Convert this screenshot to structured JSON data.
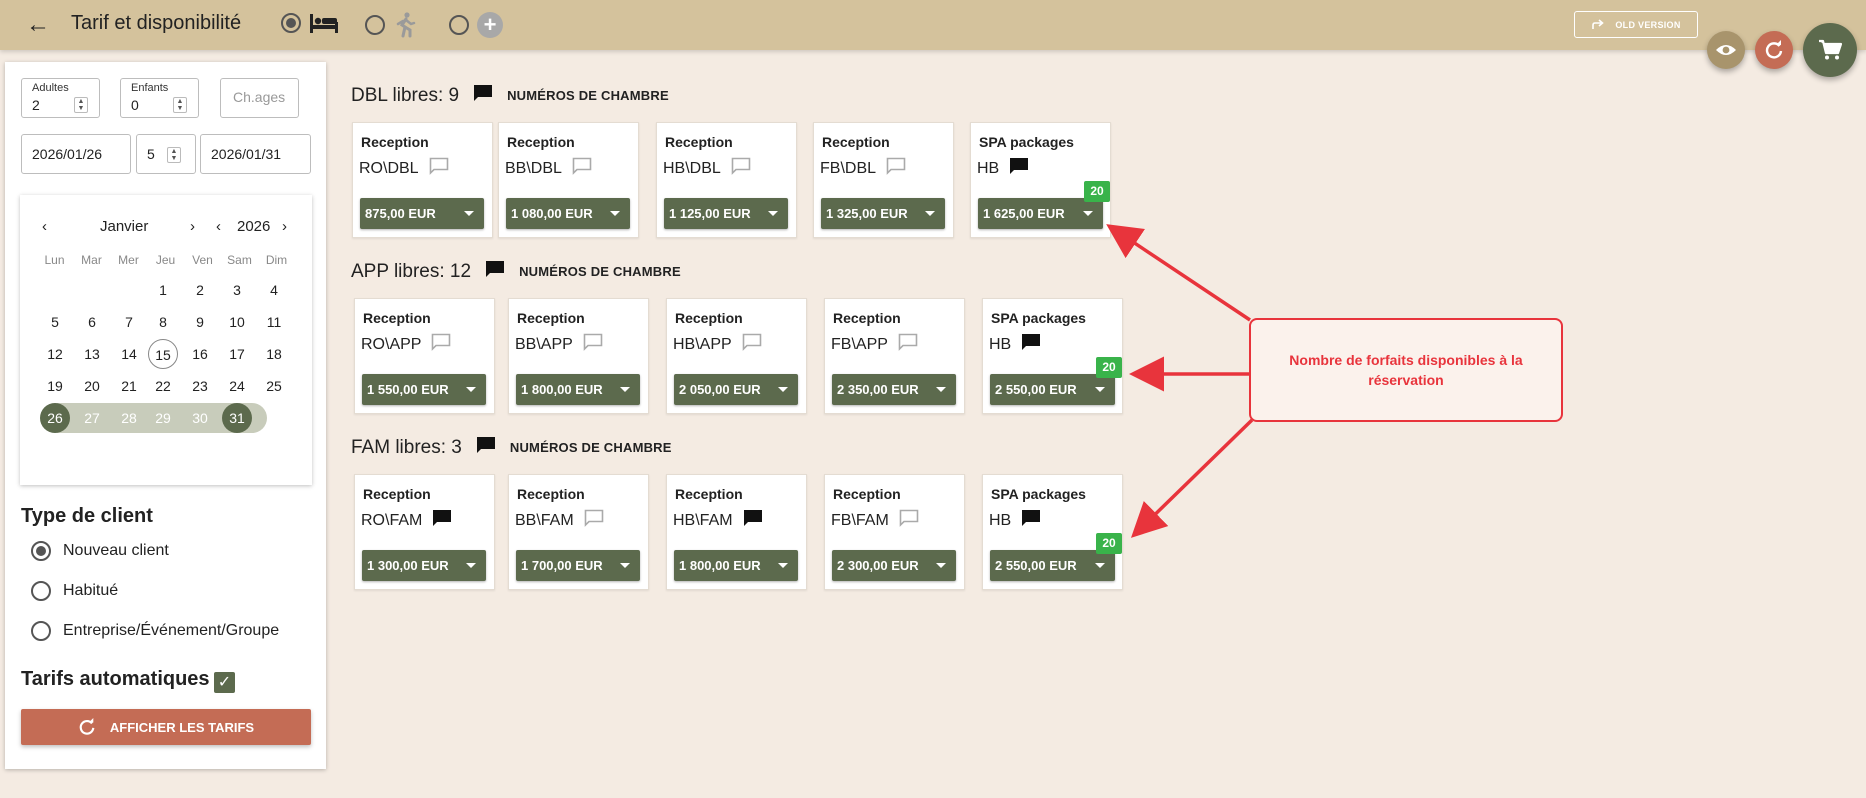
{
  "header": {
    "title": "Tarif et disponibilité",
    "old_version": "OLD VERSION",
    "accent": "#d4c29c"
  },
  "form": {
    "adults_label": "Adultes",
    "adults_value": "2",
    "children_label": "Enfants",
    "children_value": "0",
    "ages_placeholder": "Ch.ages",
    "arrival": "2026/01/26",
    "nights": "5",
    "departure": "2026/01/31"
  },
  "calendar": {
    "month": "Janvier",
    "year": "2026",
    "weekdays": [
      "Lun",
      "Mar",
      "Mer",
      "Jeu",
      "Ven",
      "Sam",
      "Dim"
    ],
    "today": "15",
    "range_start": "26",
    "range_end": "31"
  },
  "client": {
    "title": "Type de client",
    "options": [
      "Nouveau client",
      "Habitué",
      "Entreprise/Événement/Groupe"
    ],
    "selected": "Nouveau client"
  },
  "auto": {
    "title": "Tarifs automatiques",
    "checked": true,
    "button": "AFFICHER LES TARIFS"
  },
  "groups": [
    {
      "title": "DBL libres: 9",
      "link": "NUMÉROS DE CHAMBRE",
      "rates": [
        {
          "source": "Reception",
          "code": "RO\\DBL",
          "price": "875,00 EUR",
          "note": "outline"
        },
        {
          "source": "Reception",
          "code": "BB\\DBL",
          "price": "1 080,00 EUR",
          "note": "outline"
        },
        {
          "source": "Reception",
          "code": "HB\\DBL",
          "price": "1 125,00 EUR",
          "note": "outline"
        },
        {
          "source": "Reception",
          "code": "FB\\DBL",
          "price": "1 325,00 EUR",
          "note": "outline"
        },
        {
          "source": "SPA packages",
          "code": "HB",
          "price": "1 625,00 EUR",
          "note": "filled",
          "badge": "20"
        }
      ]
    },
    {
      "title": "APP libres: 12",
      "link": "NUMÉROS DE CHAMBRE",
      "rates": [
        {
          "source": "Reception",
          "code": "RO\\APP",
          "price": "1 550,00 EUR",
          "note": "outline"
        },
        {
          "source": "Reception",
          "code": "BB\\APP",
          "price": "1 800,00 EUR",
          "note": "outline"
        },
        {
          "source": "Reception",
          "code": "HB\\APP",
          "price": "2 050,00 EUR",
          "note": "outline"
        },
        {
          "source": "Reception",
          "code": "FB\\APP",
          "price": "2 350,00 EUR",
          "note": "outline"
        },
        {
          "source": "SPA packages",
          "code": "HB",
          "price": "2 550,00 EUR",
          "note": "filled",
          "badge": "20"
        }
      ]
    },
    {
      "title": "FAM libres: 3",
      "link": "NUMÉROS DE CHAMBRE",
      "rates": [
        {
          "source": "Reception",
          "code": "RO\\FAM",
          "price": "1 300,00 EUR",
          "note": "filled"
        },
        {
          "source": "Reception",
          "code": "BB\\FAM",
          "price": "1 700,00 EUR",
          "note": "outline"
        },
        {
          "source": "Reception",
          "code": "HB\\FAM",
          "price": "1 800,00 EUR",
          "note": "filled"
        },
        {
          "source": "Reception",
          "code": "FB\\FAM",
          "price": "2 300,00 EUR",
          "note": "outline"
        },
        {
          "source": "SPA packages",
          "code": "HB",
          "price": "2 550,00 EUR",
          "note": "filled",
          "badge": "20"
        }
      ]
    }
  ],
  "annotation": {
    "text": "Nombre de forfaits disponibles à la réservation",
    "color": "#e8343c"
  },
  "colors": {
    "price_button": "#5c6a4d",
    "badge": "#39b34a",
    "primary_button": "#c46c55"
  }
}
